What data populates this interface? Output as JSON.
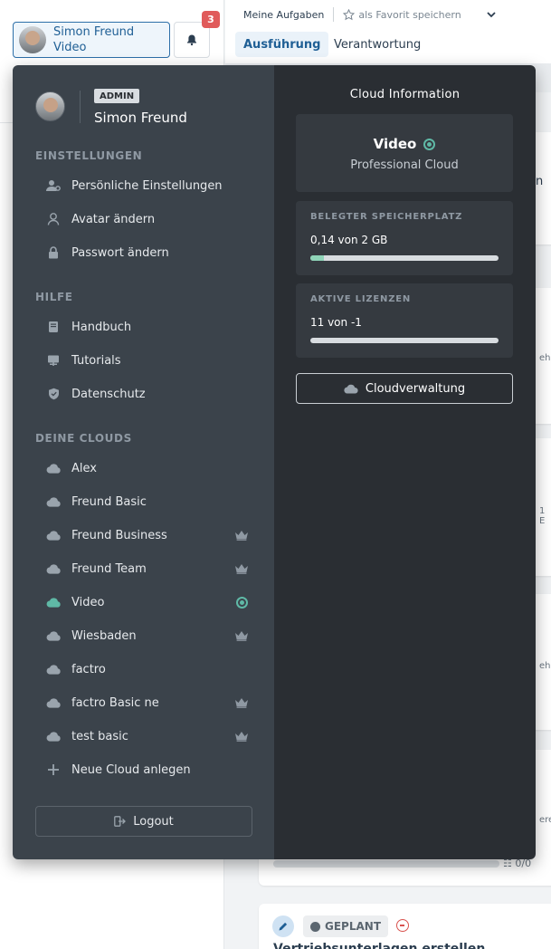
{
  "user_button": {
    "name": "Simon Freund",
    "cloud": "Video"
  },
  "notifications": {
    "count": "3"
  },
  "topbar": {
    "breadcrumb": "Meine Aufgaben",
    "favorite": "als Favorit speichern",
    "tabs": [
      {
        "label": "Ausführung",
        "active": true
      },
      {
        "label": "Verantwortung",
        "active": false
      }
    ]
  },
  "background_task": {
    "progress_count": "0/0",
    "status": "GEPLANT",
    "title_fragment": "Vertriebsunterlagen erstellen"
  },
  "background_fragments": [
    "n",
    "ehe",
    "1 E",
    "ehe",
    "ere"
  ],
  "profile": {
    "role_badge": "ADMIN",
    "name": "Simon Freund"
  },
  "sections": {
    "settings": {
      "title": "EINSTELLUNGEN",
      "items": [
        {
          "label": "Persönliche Einstellungen",
          "icon": "user-gear-icon"
        },
        {
          "label": "Avatar ändern",
          "icon": "user-icon"
        },
        {
          "label": "Passwort ändern",
          "icon": "lock-icon"
        }
      ]
    },
    "help": {
      "title": "HILFE",
      "items": [
        {
          "label": "Handbuch",
          "icon": "book-icon"
        },
        {
          "label": "Tutorials",
          "icon": "presentation-icon"
        },
        {
          "label": "Datenschutz",
          "icon": "shield-icon"
        }
      ]
    },
    "clouds": {
      "title": "DEINE CLOUDS",
      "items": [
        {
          "label": "Alex",
          "premium": false,
          "active": false
        },
        {
          "label": "Freund Basic",
          "premium": false,
          "active": false
        },
        {
          "label": "Freund Business",
          "premium": true,
          "active": false
        },
        {
          "label": "Freund Team",
          "premium": true,
          "active": false
        },
        {
          "label": "Video",
          "premium": false,
          "active": true
        },
        {
          "label": "Wiesbaden",
          "premium": true,
          "active": false
        },
        {
          "label": "factro",
          "premium": false,
          "active": false
        },
        {
          "label": "factro Basic ne",
          "premium": true,
          "active": false
        },
        {
          "label": "test basic",
          "premium": true,
          "active": false
        }
      ],
      "new_cloud": "Neue Cloud anlegen"
    }
  },
  "logout": {
    "label": "Logout"
  },
  "cloud_info": {
    "title": "Cloud Information",
    "cloud_name": "Video",
    "cloud_type": "Professional Cloud",
    "storage": {
      "label": "BELEGTER SPEICHERPLATZ",
      "value": "0,14 von 2 GB",
      "fill_fraction": 0.07
    },
    "licenses": {
      "label": "AKTIVE LIZENZEN",
      "value": "11 von -1",
      "fill_fraction": 0.0
    },
    "manage_button": "Cloudverwaltung"
  },
  "colors": {
    "panel_left": "#3b434b",
    "panel_right": "#2a2e33",
    "accent_active": "#5fb9a6",
    "badge": "#e05a5a"
  }
}
